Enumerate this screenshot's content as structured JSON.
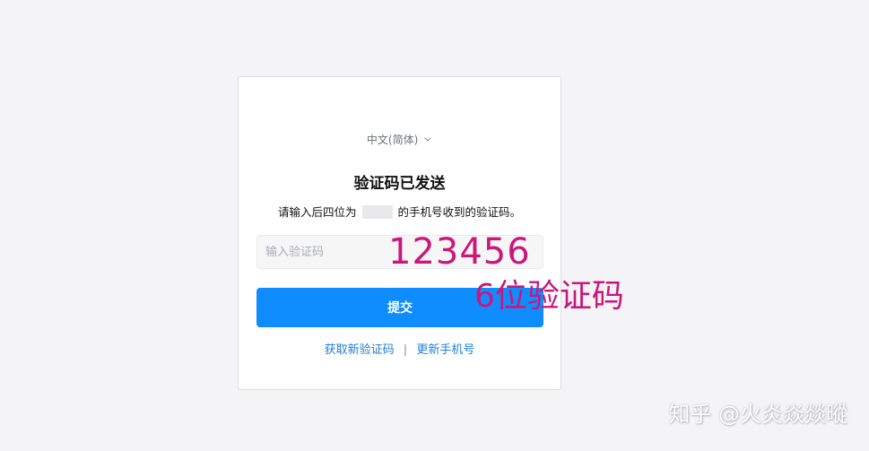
{
  "language_selector": {
    "label": "中文(简体)",
    "icon": "chevron-down-icon"
  },
  "form": {
    "title": "验证码已发送",
    "subtitle_before": "请输入后四位为",
    "subtitle_after": "的手机号收到的验证码。",
    "code_placeholder": "输入验证码",
    "submit_label": "提交",
    "resend_label": "获取新验证码",
    "separator": "|",
    "change_phone_label": "更新手机号"
  },
  "annotation": {
    "code_text": "123456",
    "label_text": "6位验证码",
    "color": "#c9177b"
  },
  "watermark": {
    "text": "知乎 @火炎焱燚暰"
  },
  "colors": {
    "primary_button": "#0f8dff",
    "link": "#1e7fd6",
    "background": "#f4f4f6"
  }
}
